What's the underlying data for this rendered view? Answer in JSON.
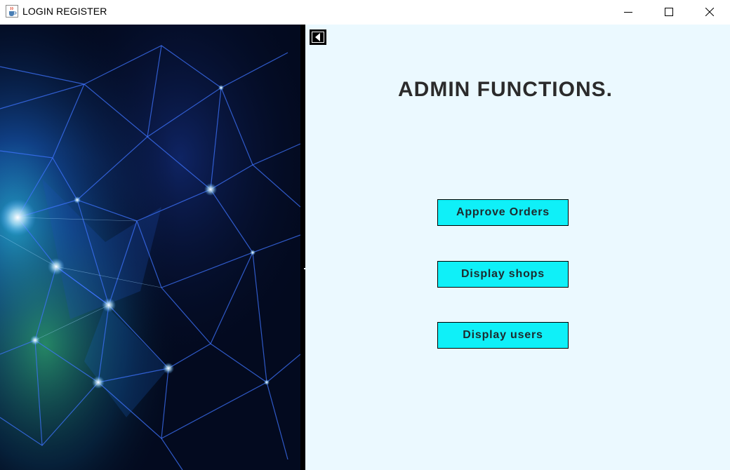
{
  "window": {
    "title": "LOGIN REGISTER",
    "app_icon": "java-cup-icon",
    "controls": {
      "minimize_icon": "minimize-icon",
      "maximize_icon": "maximize-icon",
      "close_icon": "close-icon"
    }
  },
  "left_panel": {
    "image": "network-mesh-background"
  },
  "main": {
    "back_icon": "back-arrow-icon",
    "heading": "ADMIN FUNCTIONS.",
    "buttons": [
      {
        "label": "Approve Orders"
      },
      {
        "label": "Display shops"
      },
      {
        "label": "Display users"
      }
    ]
  },
  "colors": {
    "panel_background": "#ebf9ff",
    "button_background": "#0ff0f8",
    "heading_text": "#2b2b2b",
    "image_background": "#02081a",
    "mesh_lines": "#3a6cff"
  }
}
